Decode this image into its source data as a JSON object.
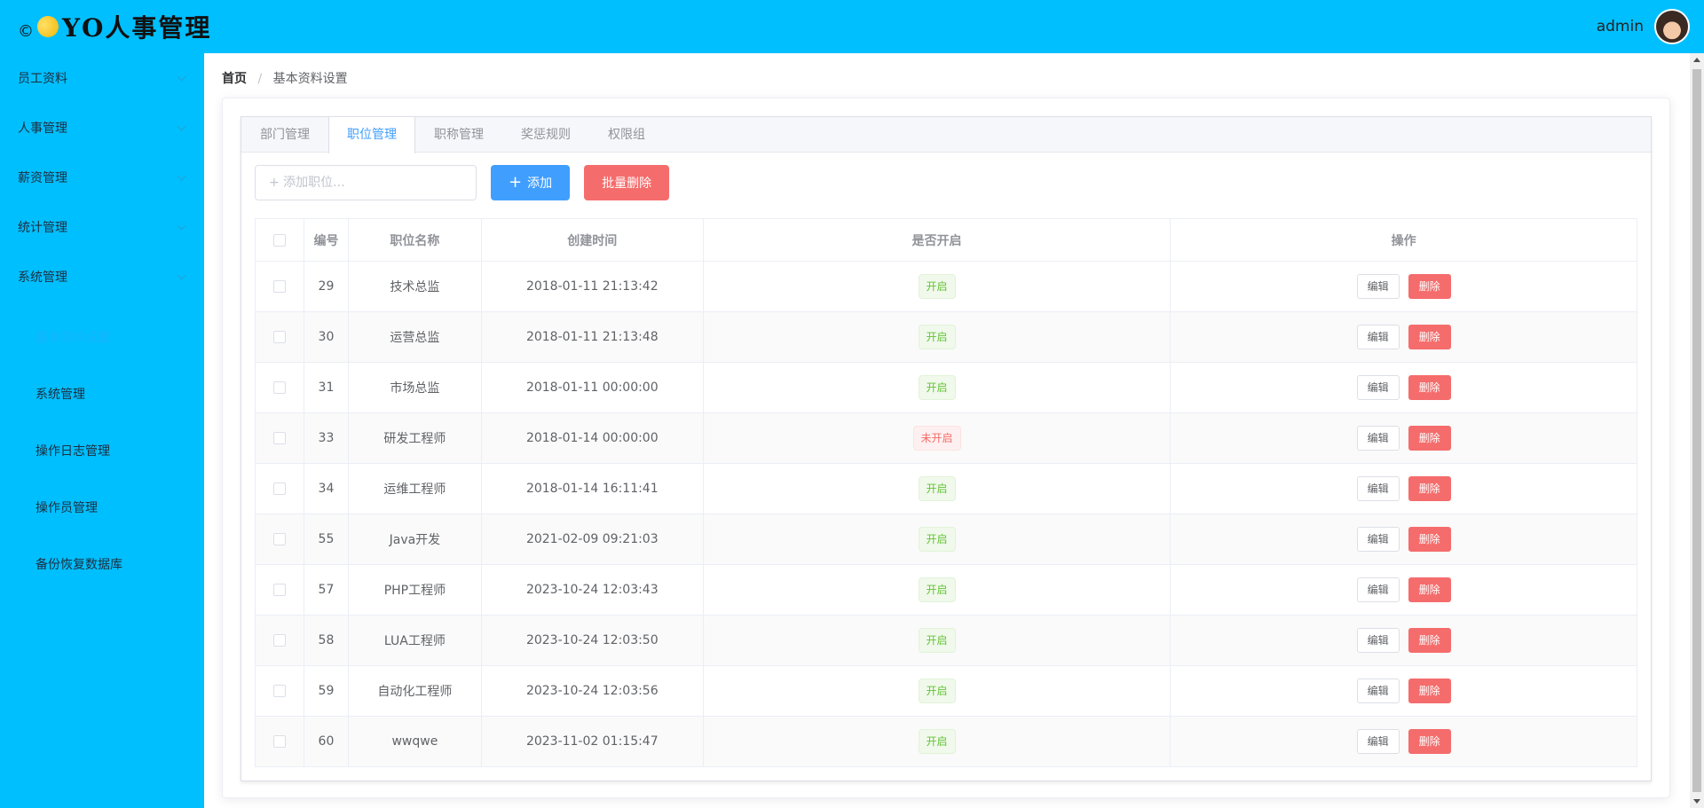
{
  "header": {
    "copyright": "©",
    "title": "YO人事管理",
    "username": "admin"
  },
  "sidebar": {
    "menus": [
      {
        "label": "员工资料"
      },
      {
        "label": "人事管理"
      },
      {
        "label": "薪资管理"
      },
      {
        "label": "统计管理"
      },
      {
        "label": "系统管理"
      }
    ],
    "submenu": [
      {
        "label": "基本资料设置",
        "active": true
      },
      {
        "label": "系统管理"
      },
      {
        "label": "操作日志管理"
      },
      {
        "label": "操作员管理"
      },
      {
        "label": "备份恢复数据库"
      }
    ]
  },
  "breadcrumb": {
    "home": "首页",
    "separator": "/",
    "current": "基本资料设置"
  },
  "tabs": [
    "部门管理",
    "职位管理",
    "职称管理",
    "奖惩规则",
    "权限组"
  ],
  "toolbar": {
    "input_placeholder": "+ 添加职位...",
    "add_label": "添加",
    "batch_delete_label": "批量删除"
  },
  "table": {
    "headers": [
      "编号",
      "职位名称",
      "创建时间",
      "是否开启",
      "操作"
    ],
    "edit_label": "编辑",
    "delete_label": "删除",
    "rows": [
      {
        "id": "29",
        "name": "技术总监",
        "created": "2018-01-11 21:13:42",
        "status": "开启",
        "enabled": true
      },
      {
        "id": "30",
        "name": "运营总监",
        "created": "2018-01-11 21:13:48",
        "status": "开启",
        "enabled": true
      },
      {
        "id": "31",
        "name": "市场总监",
        "created": "2018-01-11 00:00:00",
        "status": "开启",
        "enabled": true
      },
      {
        "id": "33",
        "name": "研发工程师",
        "created": "2018-01-14 00:00:00",
        "status": "未开启",
        "enabled": false
      },
      {
        "id": "34",
        "name": "运维工程师",
        "created": "2018-01-14 16:11:41",
        "status": "开启",
        "enabled": true
      },
      {
        "id": "55",
        "name": "Java开发",
        "created": "2021-02-09 09:21:03",
        "status": "开启",
        "enabled": true
      },
      {
        "id": "57",
        "name": "PHP工程师",
        "created": "2023-10-24 12:03:43",
        "status": "开启",
        "enabled": true
      },
      {
        "id": "58",
        "name": "LUA工程师",
        "created": "2023-10-24 12:03:50",
        "status": "开启",
        "enabled": true
      },
      {
        "id": "59",
        "name": "自动化工程师",
        "created": "2023-10-24 12:03:56",
        "status": "开启",
        "enabled": true
      },
      {
        "id": "60",
        "name": "wwqwe",
        "created": "2023-11-02 01:15:47",
        "status": "开启",
        "enabled": true
      }
    ]
  },
  "colors": {
    "brand": "#00bfff",
    "primary": "#409eff",
    "danger": "#f56c6c",
    "success": "#67c23a"
  }
}
